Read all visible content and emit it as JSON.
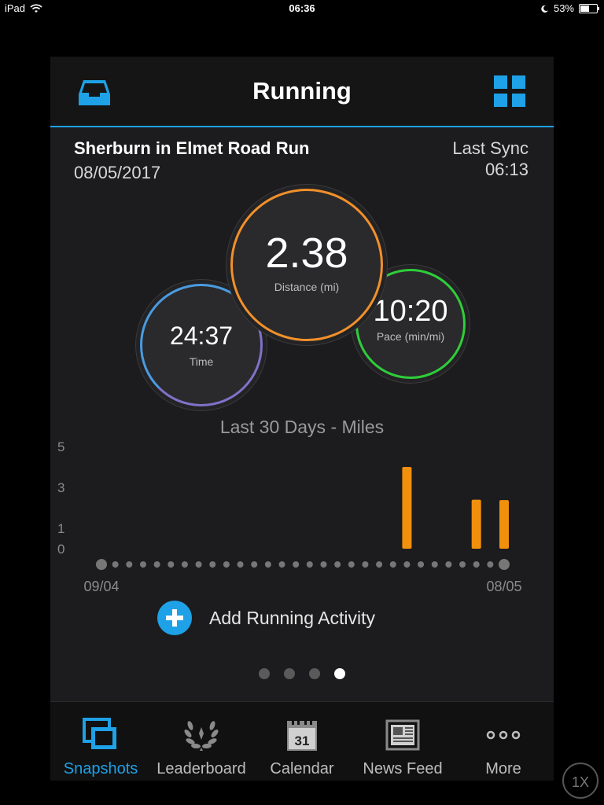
{
  "status_bar": {
    "device": "iPad",
    "time": "06:36",
    "battery": "53%",
    "battery_level": 0.53
  },
  "header": {
    "title": "Running",
    "left_icon": "inbox-icon",
    "right_icon": "grid-icon",
    "accent": "#1ea1e6"
  },
  "activity": {
    "name": "Sherburn in Elmet Road Run",
    "date": "08/05/2017",
    "sync_label": "Last Sync",
    "sync_time": "06:13"
  },
  "stats": {
    "distance": {
      "value": "2.38",
      "label": "Distance (mi)",
      "color": "#f1902a"
    },
    "time": {
      "value": "24:37",
      "label": "Time",
      "color": "#7f72c8"
    },
    "pace": {
      "value": "10:20",
      "label": "Pace (min/mi)",
      "color": "#2fcd3a"
    }
  },
  "chart_data": {
    "type": "bar",
    "title": "Last 30 Days - Miles",
    "y_ticks": [
      "5",
      "3",
      "1",
      "0"
    ],
    "ylim": [
      0,
      5
    ],
    "x_start_label": "09/04",
    "x_end_label": "08/05",
    "day_count": 30,
    "bars": [
      {
        "day_index": 22,
        "value": 4.0
      },
      {
        "day_index": 27,
        "value": 2.4
      },
      {
        "day_index": 29,
        "value": 2.38
      }
    ],
    "bar_color": "#f0900c",
    "grid": false
  },
  "add_activity": {
    "label": "Add Running Activity"
  },
  "pager": {
    "count": 4,
    "active_index": 3
  },
  "tabs": [
    {
      "label": "Snapshots",
      "icon": "snapshots-icon",
      "active": true
    },
    {
      "label": "Leaderboard",
      "icon": "laurel-icon",
      "active": false
    },
    {
      "label": "Calendar",
      "icon": "calendar-icon",
      "icon_text": "31",
      "active": false
    },
    {
      "label": "News Feed",
      "icon": "newspaper-icon",
      "active": false
    },
    {
      "label": "More",
      "icon": "more-icon",
      "active": false
    }
  ],
  "zoom_button": "1X"
}
